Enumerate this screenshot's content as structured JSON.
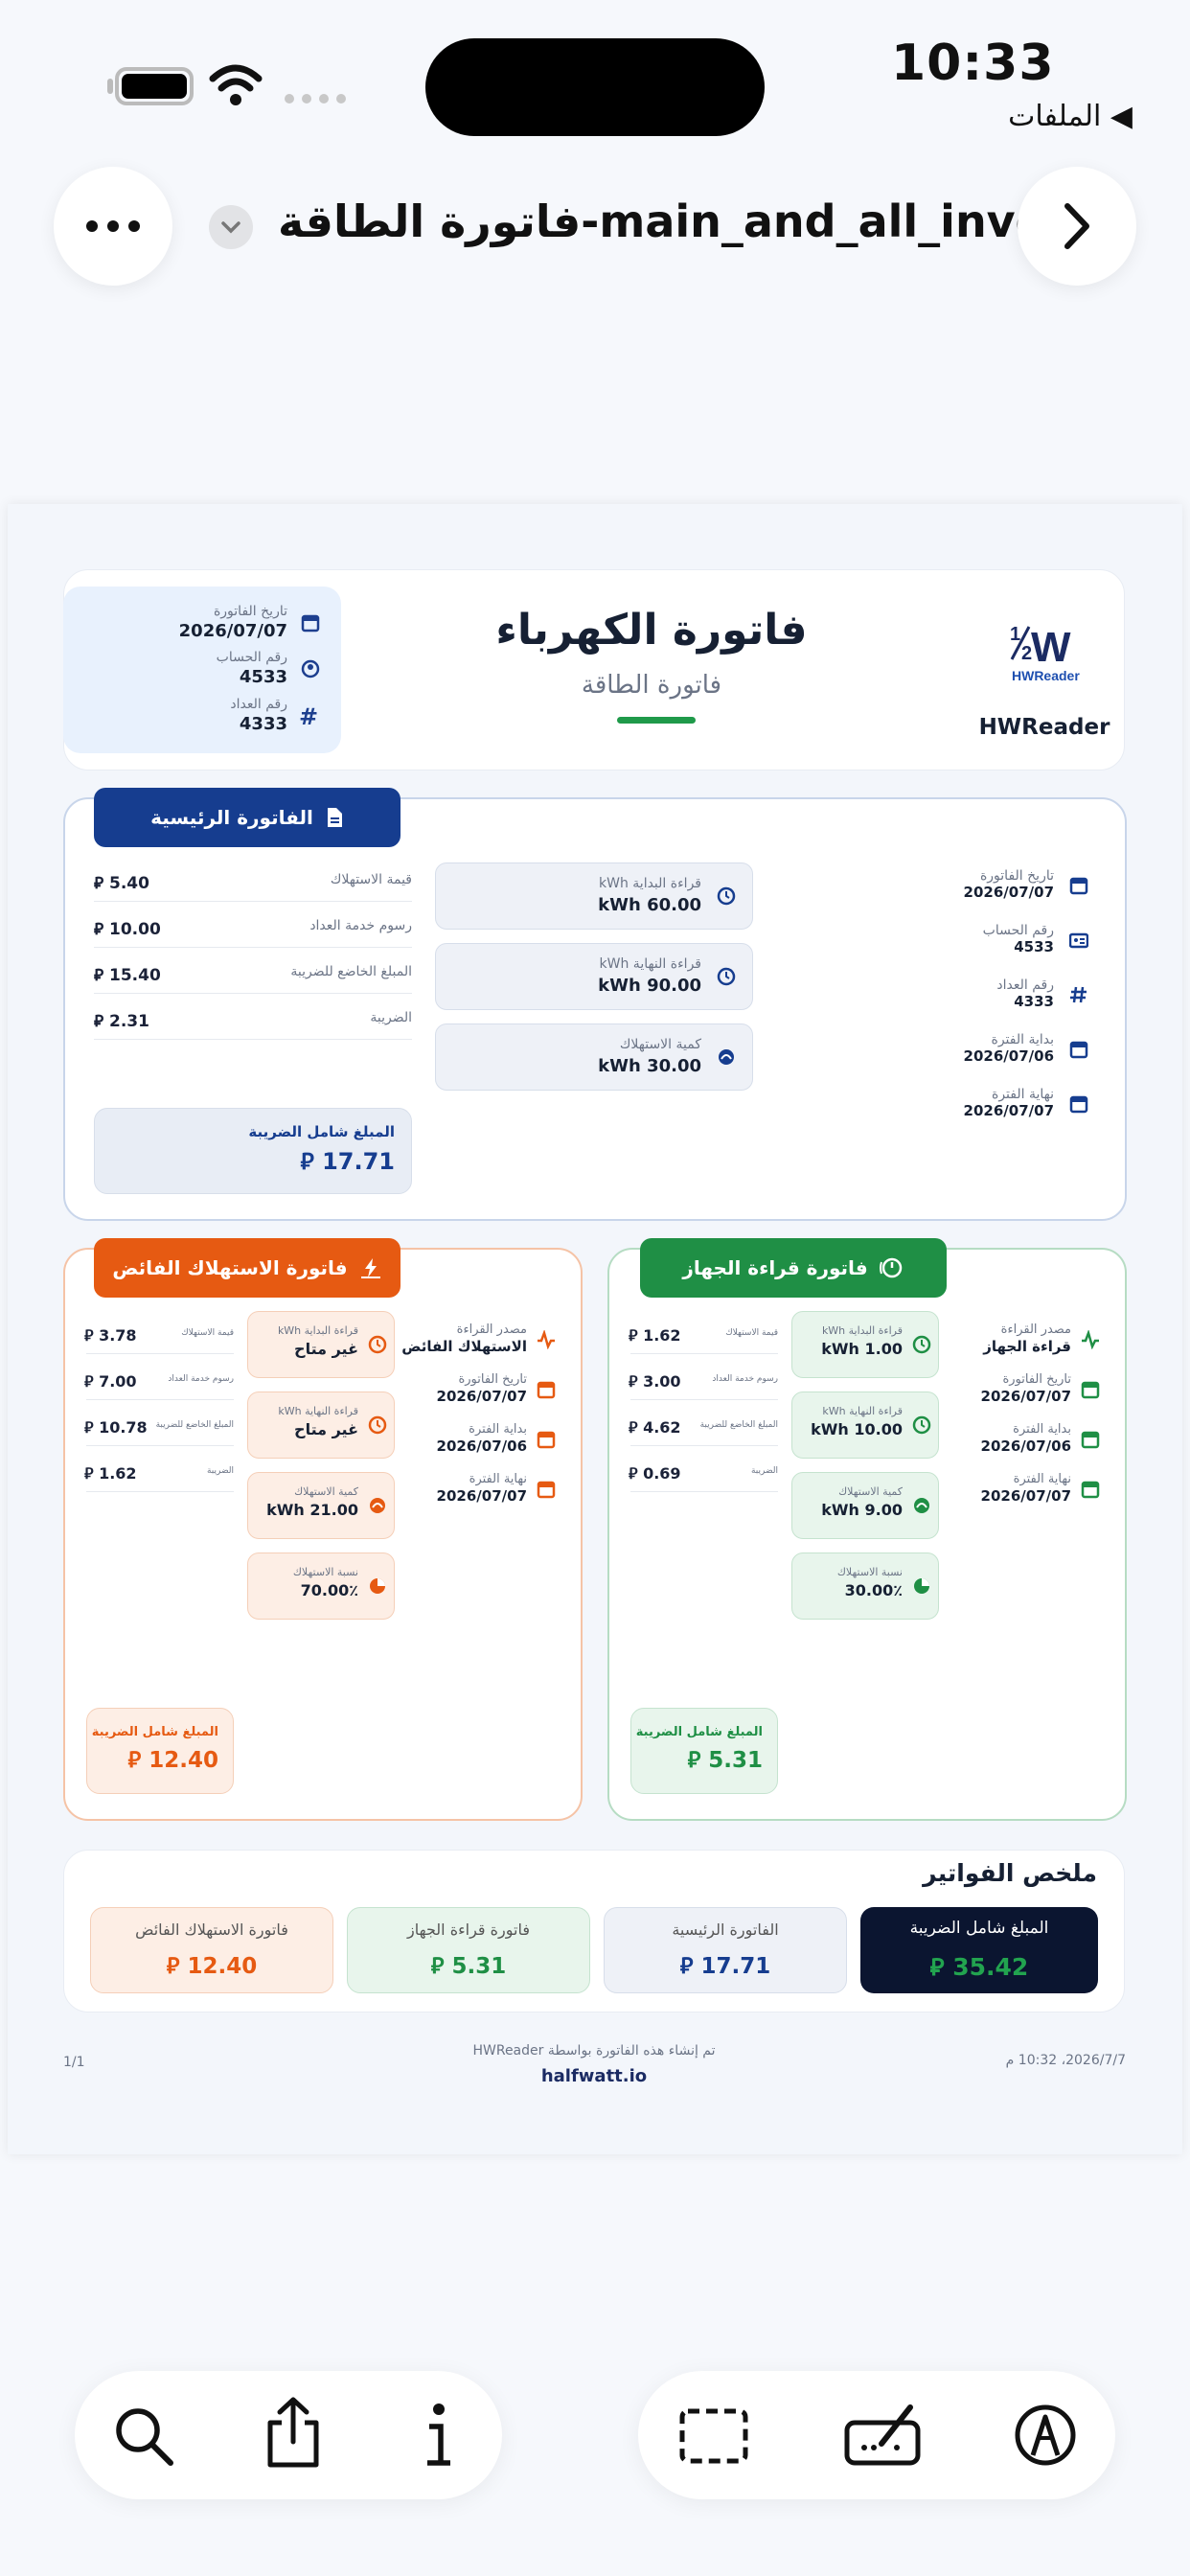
{
  "status": {
    "time": "10:33",
    "back_label": "◀ الملفات"
  },
  "nav": {
    "title": "فاتورة الطاقة-main_and_all_invo...",
    "more_icon": "ellipsis-icon",
    "forward_icon": "chevron-right-icon"
  },
  "doc": {
    "brand": "HWReader",
    "title": "فاتورة الكهرباء",
    "subtitle": "فاتورة الطاقة",
    "info": [
      {
        "label": "تاريخ الفاتورة",
        "value": "2026/07/07"
      },
      {
        "label": "رقم الحساب",
        "value": "4533"
      },
      {
        "label": "رقم العداد",
        "value": "4333"
      }
    ],
    "main": {
      "badge": "الفاتورة الرئيسية",
      "details": [
        {
          "label": "تاريخ الفاتورة",
          "value": "2026/07/07"
        },
        {
          "label": "رقم الحساب",
          "value": "4533"
        },
        {
          "label": "رقم العداد",
          "value": "4333"
        },
        {
          "label": "بداية الفترة",
          "value": "2026/07/06"
        },
        {
          "label": "نهاية الفترة",
          "value": "2026/07/07"
        }
      ],
      "readings": [
        {
          "label": "قراءة البداية kWh",
          "value": "60.00 kWh"
        },
        {
          "label": "قراءة النهاية kWh",
          "value": "90.00 kWh"
        },
        {
          "label": "كمية الاستهلاك",
          "value": "30.00 kWh"
        }
      ],
      "charges": [
        {
          "label": "قيمة الاستهلاك",
          "value": "5.40"
        },
        {
          "label": "رسوم خدمة العداد",
          "value": "10.00"
        },
        {
          "label": "المبلغ الخاضع للضريبة",
          "value": "15.40"
        },
        {
          "label": "الضريبة",
          "value": "2.31"
        }
      ],
      "total_label": "المبلغ شامل الضريبة",
      "total_value": "17.71"
    },
    "device": {
      "badge": "فاتورة قراءة الجهاز",
      "details": [
        {
          "label": "مصدر القراءة",
          "value": "قراءة الجهاز"
        },
        {
          "label": "تاريخ الفاتورة",
          "value": "2026/07/07"
        },
        {
          "label": "بداية الفترة",
          "value": "2026/07/06"
        },
        {
          "label": "نهاية الفترة",
          "value": "2026/07/07"
        }
      ],
      "readings": [
        {
          "label": "قراءة البداية kWh",
          "value": "1.00 kWh"
        },
        {
          "label": "قراءة النهاية kWh",
          "value": "10.00 kWh"
        },
        {
          "label": "كمية الاستهلاك",
          "value": "9.00 kWh"
        },
        {
          "label": "نسبة الاستهلاك",
          "value": "30.00٪"
        }
      ],
      "charges": [
        {
          "label": "قيمة الاستهلاك",
          "value": "1.62"
        },
        {
          "label": "رسوم خدمة العداد",
          "value": "3.00"
        },
        {
          "label": "المبلغ الخاضع للضريبة",
          "value": "4.62"
        },
        {
          "label": "الضريبة",
          "value": "0.69"
        }
      ],
      "total_label": "المبلغ شامل الضريبة",
      "total_value": "5.31"
    },
    "excess": {
      "badge": "فاتورة الاستهلاك الفائض",
      "details": [
        {
          "label": "مصدر القراءة",
          "value": "الاستهلاك الفائض"
        },
        {
          "label": "تاريخ الفاتورة",
          "value": "2026/07/07"
        },
        {
          "label": "بداية الفترة",
          "value": "2026/07/06"
        },
        {
          "label": "نهاية الفترة",
          "value": "2026/07/07"
        }
      ],
      "readings": [
        {
          "label": "قراءة البداية kWh",
          "value": "غير متاح"
        },
        {
          "label": "قراءة النهاية kWh",
          "value": "غير متاح"
        },
        {
          "label": "كمية الاستهلاك",
          "value": "21.00 kWh"
        },
        {
          "label": "نسبة الاستهلاك",
          "value": "70.00٪"
        }
      ],
      "charges": [
        {
          "label": "قيمة الاستهلاك",
          "value": "3.78"
        },
        {
          "label": "رسوم خدمة العداد",
          "value": "7.00"
        },
        {
          "label": "المبلغ الخاضع للضريبة",
          "value": "10.78"
        },
        {
          "label": "الضريبة",
          "value": "1.62"
        }
      ],
      "total_label": "المبلغ شامل الضريبة",
      "total_value": "12.40"
    },
    "summary": {
      "title": "ملخص الفواتير",
      "items": [
        {
          "label": "المبلغ شامل الضريبة",
          "value": "35.42"
        },
        {
          "label": "الفاتورة الرئيسية",
          "value": "17.71"
        },
        {
          "label": "فاتورة قراءة الجهاز",
          "value": "5.31"
        },
        {
          "label": "فاتورة الاستهلاك الفائض",
          "value": "12.40"
        }
      ]
    },
    "footer": {
      "generated": "تم إنشاء هذه الفاتورة بواسطة HWReader",
      "site": "halfwatt.io",
      "datetime": "2026/7/7، 10:32 م",
      "page": "1/1"
    },
    "currency_symbol": "⃁",
    "colors": {
      "main": "#163d8f",
      "device": "#1f8f45",
      "excess": "#e65a12",
      "navy": "#0b1530"
    }
  },
  "toolbar": {
    "left": [
      "search-icon",
      "share-icon",
      "info-icon"
    ],
    "right": [
      "select-icon",
      "signature-icon",
      "markup-icon"
    ]
  }
}
